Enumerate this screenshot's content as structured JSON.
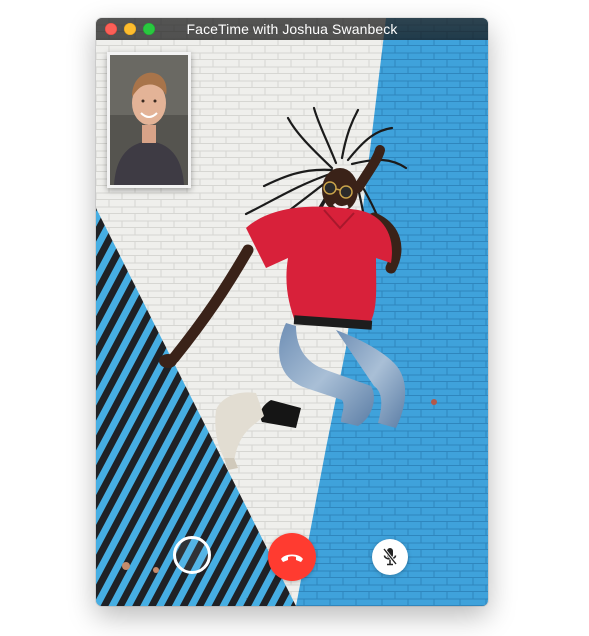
{
  "window": {
    "title": "FaceTime with Joshua Swanbeck"
  },
  "titlebar": {
    "close_icon": "close-icon",
    "minimize_icon": "minimize-icon",
    "zoom_icon": "zoom-icon"
  },
  "remote_video": {
    "subject": "remote-video-feed"
  },
  "self_view": {
    "subject": "self-view-feed"
  },
  "controls": {
    "record_icon": "record-icon",
    "end_call_icon": "end-call-icon",
    "mute_icon": "microphone-mute-icon"
  },
  "colors": {
    "end_call": "#ff3b30",
    "brick_blue": "#3d9fd8",
    "brick_white": "#eeeeec",
    "stripe_dark": "#202226",
    "shirt_red": "#d8213a"
  }
}
